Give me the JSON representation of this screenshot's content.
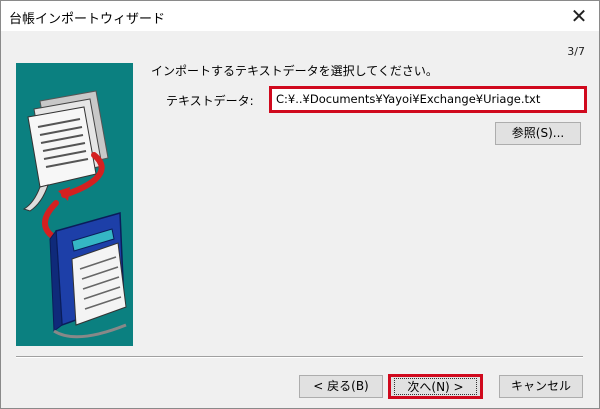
{
  "window": {
    "title": "台帳インポートウィザード",
    "close_glyph": "✕"
  },
  "wizard": {
    "step": "3/7",
    "instruction": "インポートするテキストデータを選択してください。",
    "field_label": "テキストデータ:",
    "file_path": "C:¥..¥Documents¥Yayoi¥Exchange¥Uriage.txt",
    "browse_label": "参照(S)..."
  },
  "footer": {
    "back_label": "< 戻る(B)",
    "next_label": "次へ(N) >",
    "cancel_label": "キャンセル"
  },
  "colors": {
    "illustration_bg": "#0b8080",
    "highlight": "#d0091d"
  },
  "illustration": {
    "icons": [
      "document-stack-icon",
      "red-arrow-icon",
      "blue-book-icon"
    ]
  }
}
